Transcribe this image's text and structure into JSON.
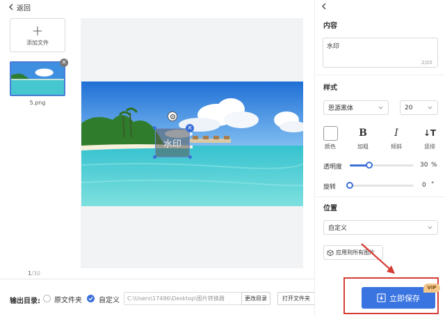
{
  "header": {
    "back_label": "返回"
  },
  "left": {
    "add_file_label": "添加文件",
    "thumbnails": [
      {
        "name": "5.png"
      }
    ],
    "page_current": "1",
    "page_total": "/30"
  },
  "watermark": {
    "text": "水印"
  },
  "output": {
    "label": "输出目录:",
    "option_original": "原文件夹",
    "option_custom": "自定义",
    "selected": "custom",
    "path": "C:\\Users\\17486\\Desktop\\图片转换器",
    "change_dir_label": "更改目录",
    "open_folder_label": "打开文件夹"
  },
  "panel": {
    "content_title": "内容",
    "content_value": "水印",
    "content_count": "2/20",
    "style_title": "样式",
    "font_family": "思源黑体",
    "font_size": "20",
    "color_label": "颜色",
    "bold_label": "加粗",
    "italic_label": "倾斜",
    "vertical_label": "竖排",
    "bold_glyph": "B",
    "italic_glyph": "I",
    "vertical_glyph": "↓T",
    "opacity_label": "透明度",
    "opacity_value": "30",
    "opacity_unit": "%",
    "opacity_fraction": 0.3,
    "rotate_label": "旋转",
    "rotate_value": "0",
    "rotate_unit": "°",
    "rotate_fraction": 0,
    "position_title": "位置",
    "position_value": "自定义",
    "apply_all_label": "应用到所有图片"
  },
  "save": {
    "label": "立即保存",
    "vip_badge": "VIP"
  },
  "colors": {
    "accent": "#3a74e0",
    "highlight": "#d63c34",
    "vip": "#f3c78a"
  }
}
